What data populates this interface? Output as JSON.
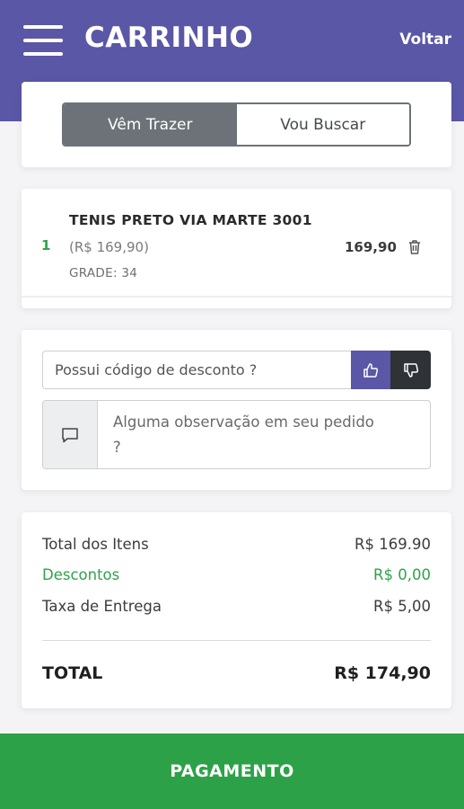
{
  "header": {
    "title": "CARRINHO",
    "back_label": "Voltar",
    "color": "#5a57a6"
  },
  "delivery_toggle": {
    "options": [
      "Vêm Trazer",
      "Vou Buscar"
    ],
    "selected": "Vêm Trazer"
  },
  "cart": {
    "items": [
      {
        "quantity": "1",
        "name": "TENIS PRETO VIA MARTE 3001",
        "unit_price": "(R$ 169,90)",
        "grade": "GRADE: 34",
        "total": "169,90",
        "delete_icon": "trash-icon"
      }
    ]
  },
  "discount": {
    "placeholder": "Possui código de desconto ?",
    "confirm_icon": "thumbs-up-icon",
    "reject_icon": "thumbs-down-icon"
  },
  "observation": {
    "placeholder": "Alguma observação em seu pedido ?",
    "icon": "chat-bubble-icon"
  },
  "summary": {
    "items_label": "Total dos Itens",
    "items_value": "R$ 169.90",
    "discount_label": "Descontos",
    "discount_value": "R$ 0,00",
    "delivery_label": "Taxa de Entrega",
    "delivery_value": "R$ 5,00",
    "total_label": "TOTAL",
    "total_value": "R$ 174,90"
  },
  "payment": {
    "label": "PAGAMENTO",
    "color": "#2da148"
  }
}
